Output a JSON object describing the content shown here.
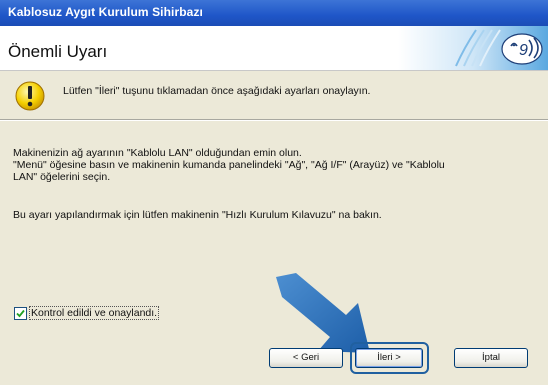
{
  "window": {
    "title": "Kablosuz Aygıt Kurulum Sihirbazı"
  },
  "header": {
    "title": "Önemli Uyarı"
  },
  "warning": {
    "text": "Lütfen \"İleri\" tuşunu tıklamadan önce aşağıdaki ayarları onaylayın."
  },
  "body": {
    "line1": "Makinenizin ağ ayarının \"Kablolu LAN\" olduğundan emin olun.",
    "line2": "\"Menü\" öğesine basın ve makinenin kumanda panelindeki \"Ağ\", \"Ağ I/F\" (Arayüz) ve \"Kablolu",
    "line3": "LAN\" öğelerini seçin.",
    "line4": "Bu ayarı yapılandırmak için lütfen makinenin \"Hızlı Kurulum Kılavuzu\" na bakın."
  },
  "checkbox": {
    "label": "Kontrol edildi ve onaylandı.",
    "checked": true
  },
  "buttons": {
    "back": "< Geri",
    "next": "İleri >",
    "cancel": "İptal"
  },
  "colors": {
    "titlebar": "#245edb",
    "accent_arrow": "#2a6fb6",
    "content_bg": "#ece9d8"
  },
  "icons": {
    "warning": "warning-icon",
    "logo": "wireless-logo-icon",
    "arrow": "pointer-arrow"
  }
}
